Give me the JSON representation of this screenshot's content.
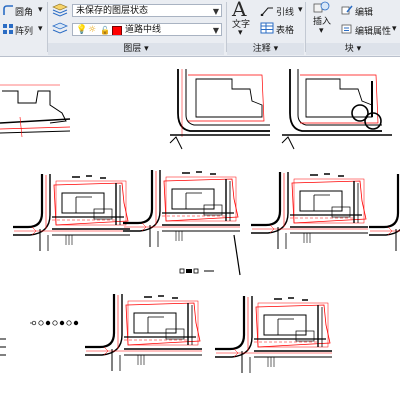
{
  "ribbon": {
    "modify": {
      "fillet": "圆角",
      "array": "阵列"
    },
    "layers": {
      "state_value": "未保存的图层状态",
      "current_layer": "道路中线",
      "current_layer_color": "#ff0000",
      "panel_label": "图层"
    },
    "annotation": {
      "text": "文字",
      "leader": "引线",
      "table": "表格",
      "panel_label": "注释"
    },
    "block": {
      "insert": "插入",
      "edit": "编辑",
      "edit_attributes": "编辑属性",
      "panel_label": "块"
    }
  },
  "colors": {
    "ribbon_bg": "#eaedf2",
    "accent_blue": "#2a6cc4",
    "outline_red": "#ff0000"
  }
}
